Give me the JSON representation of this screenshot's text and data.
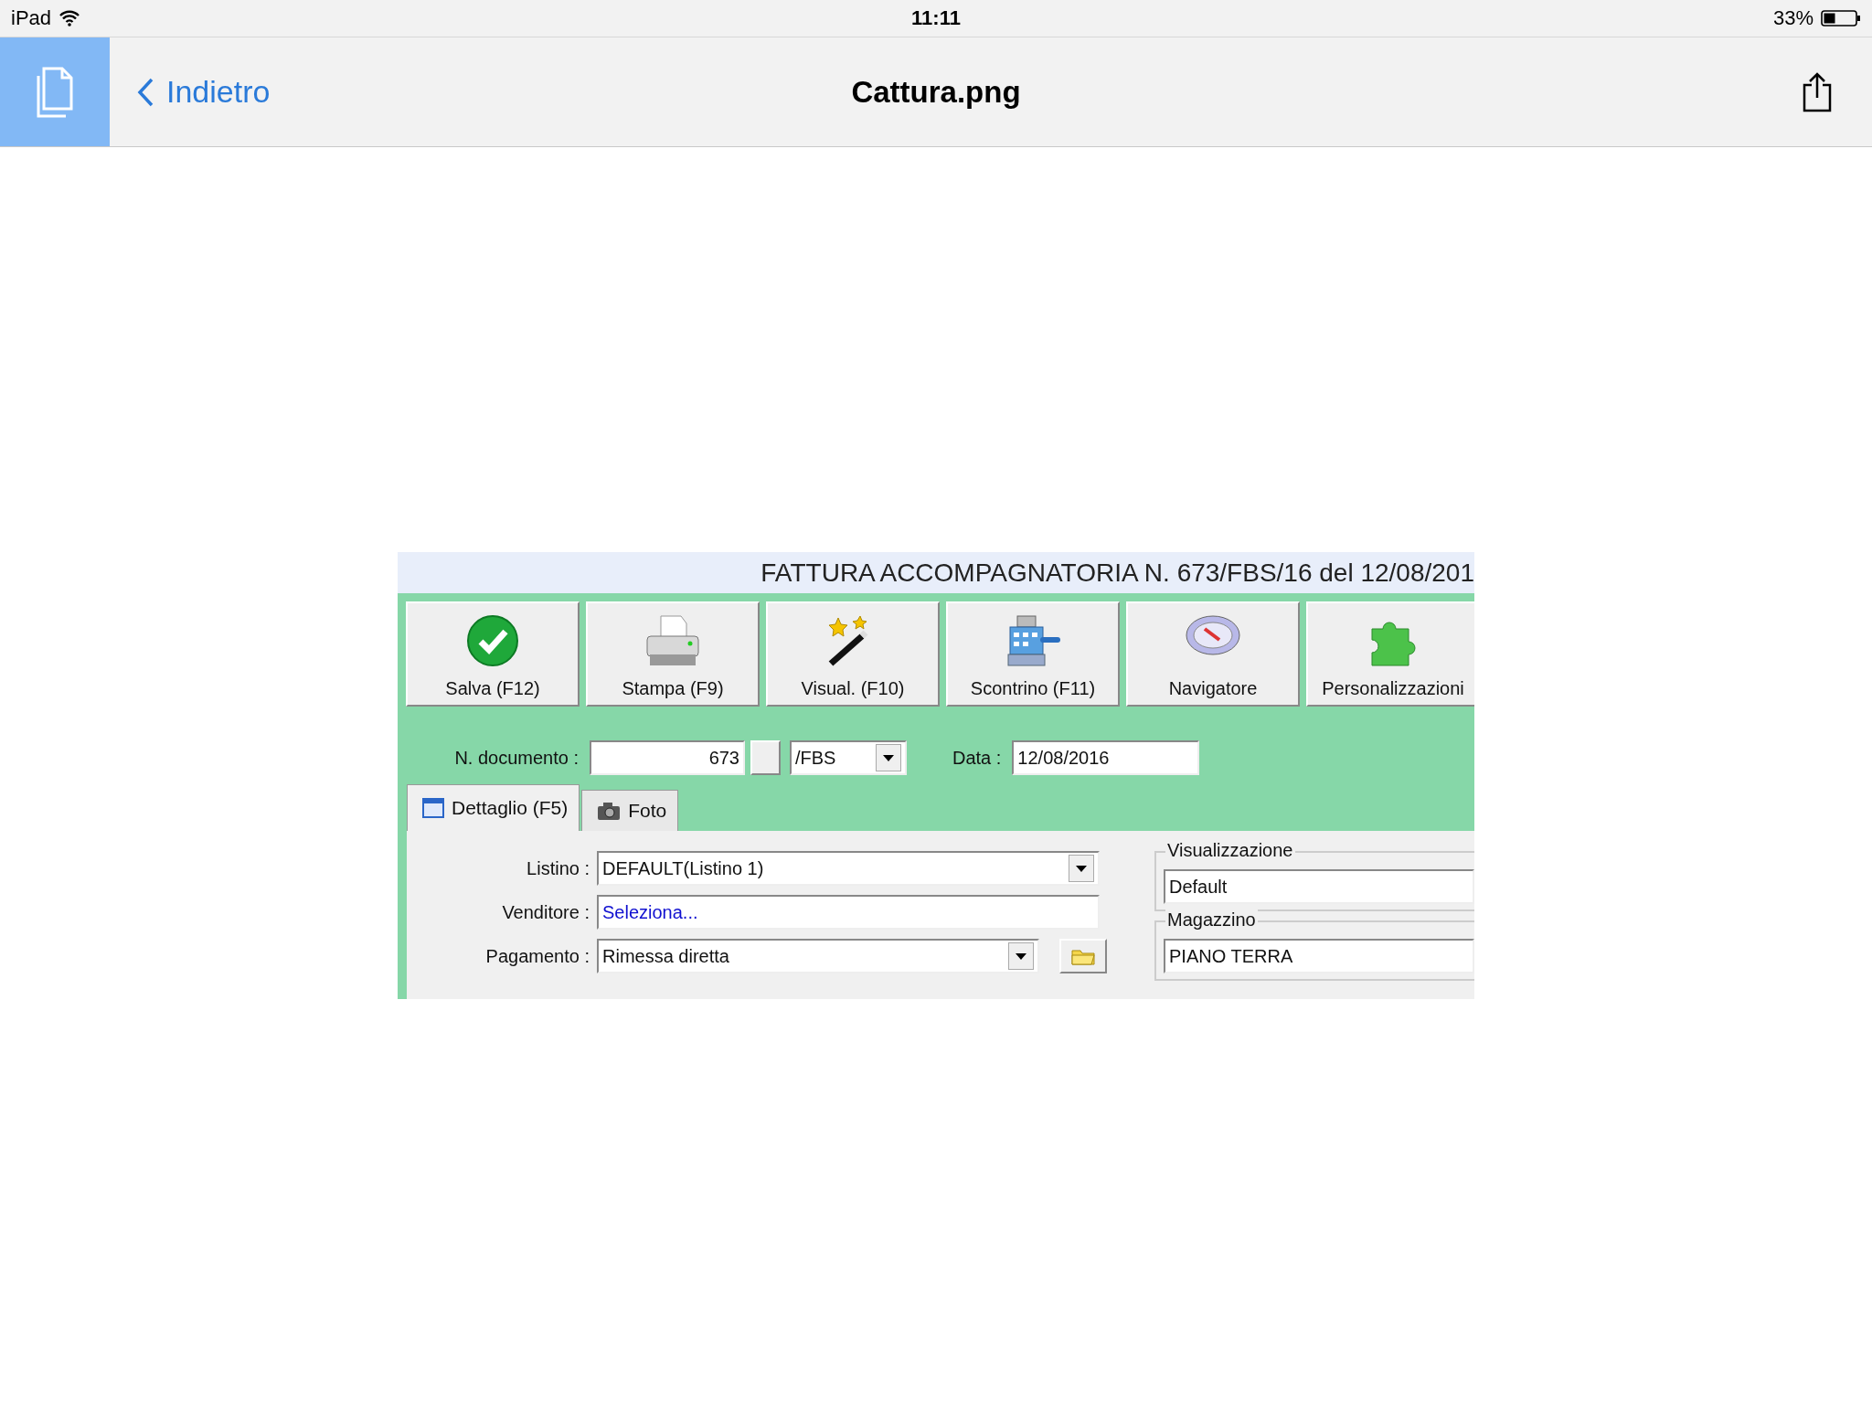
{
  "status_bar": {
    "device": "iPad",
    "time": "11:11",
    "battery": "33%"
  },
  "nav_bar": {
    "back": "Indietro",
    "title": "Cattura.png"
  },
  "document_image": {
    "title": "FATTURA ACCOMPAGNATORIA N. 673/FBS/16 del 12/08/201",
    "toolbar": [
      {
        "label": "Salva (F12)",
        "kind": "check"
      },
      {
        "label": "Stampa (F9)",
        "kind": "printer"
      },
      {
        "label": "Visual. (F10)",
        "kind": "wand"
      },
      {
        "label": "Scontrino (F11)",
        "kind": "register"
      },
      {
        "label": "Navigatore",
        "kind": "compass"
      },
      {
        "label": "Personalizzazioni",
        "kind": "puzzle"
      }
    ],
    "doc_number": {
      "label": "N. documento :",
      "value": "673",
      "series": "/FBS"
    },
    "date": {
      "label": "Data :",
      "value": "12/08/2016"
    },
    "tabs": [
      {
        "label": "Dettaglio (F5)",
        "selected": true,
        "kind": "calendar"
      },
      {
        "label": "Foto",
        "selected": false,
        "kind": "camera"
      }
    ],
    "fields": [
      {
        "label": "Listino :",
        "value": "DEFAULT(Listino 1)",
        "kind": "dropdown"
      },
      {
        "label": "Venditore :",
        "value": "Seleziona...",
        "kind": "link"
      },
      {
        "label": "Pagamento :",
        "value": "Rimessa diretta",
        "kind": "dropdown_folder"
      }
    ],
    "groups": [
      {
        "title": "Visualizzazione",
        "value": "Default"
      },
      {
        "title": "Magazzino",
        "value": "PIANO TERRA"
      }
    ]
  }
}
